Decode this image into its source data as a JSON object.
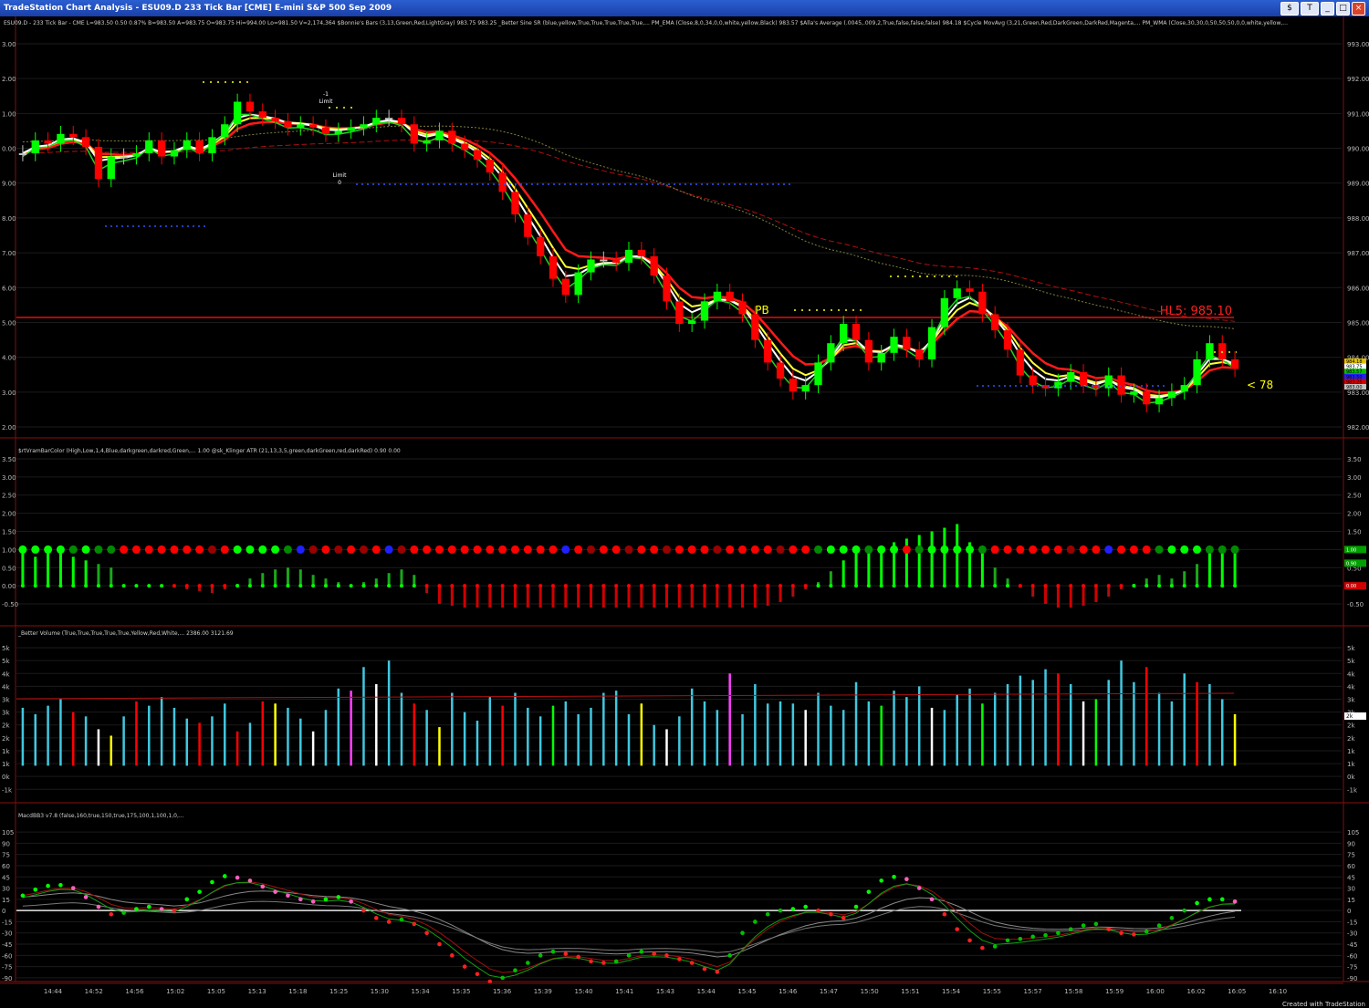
{
  "window": {
    "title": "TradeStation Chart Analysis - ESU09.D 233 Tick Bar [CME] E-mini S&P 500 Sep 2009",
    "btn1": "$",
    "btn2": "T"
  },
  "footer": "Created with TradeStation",
  "colors": {
    "bg": "#000000",
    "grid": "#1b1b1b",
    "bull": "#00ff00",
    "bear": "#ff0000",
    "neutral": "#c0c0c0",
    "white": "#ffffff",
    "yellow": "#ffff00",
    "red_line": "#e01818",
    "green_line": "#00d000",
    "cyan": "#40c8e0",
    "blue": "#2020ff",
    "magenta": "#ff40ff"
  },
  "time_axis": [
    "14:44",
    "14:52",
    "14:56",
    "15:02",
    "15:05",
    "15:13",
    "15:18",
    "15:25",
    "15:30",
    "15:34",
    "15:35",
    "15:36",
    "15:39",
    "15:40",
    "15:41",
    "15:43",
    "15:44",
    "15:45",
    "15:46",
    "15:47",
    "15:50",
    "15:51",
    "15:54",
    "15:55",
    "15:57",
    "15:58",
    "15:59",
    "16:00",
    "16:02",
    "16:05",
    "16:10"
  ],
  "chart_data": [
    {
      "type": "candlestick",
      "status": "ESU09.D - 233 Tick Bar - CME  L=983.50  0.50  0.87%  B=983.50  A=983.75  O=983.75  Hi=994.00  Lo=981.50  V=2,174,364  $Bonnie's Bars (3,13,Green,Red,LightGray)  983.75  983.25  _Better Sine SR (blue,yellow,True,True,True,True,True,...  PM_EMA (Close,8,0,34,0,0,white,yellow,Black)  983.57  $Alla's Average (.0045,.009,2,True,false,false,false)  984.18  $Cycle MovAvg (3,21,Green,Red,DarkGreen,DarkRed,Magenta,...  PM_WMA (Close,30,30,0,50,50,50,0,0,white,yellow,...",
      "y_ticks_left": [
        "3.00",
        "2.00",
        "1.00",
        "0.00",
        "9.00",
        "8.00",
        "7.00",
        "6.00",
        "5.00",
        "4.00",
        "3.00",
        "2.00"
      ],
      "y_ticks_right": [
        "993.00",
        "992.00",
        "991.00",
        "990.00",
        "989.00",
        "988.00",
        "987.00",
        "986.00",
        "985.00",
        "984.00",
        "983.00",
        "982.00"
      ],
      "ylim": [
        981.7,
        993.6
      ],
      "close": [
        990.2,
        990.6,
        990.5,
        990.8,
        990.7,
        990.4,
        989.4,
        990.1,
        990.1,
        990.2,
        990.6,
        990.1,
        990.3,
        990.6,
        990.2,
        990.7,
        991.1,
        991.8,
        991.5,
        991.3,
        991.2,
        991.0,
        991.1,
        991.0,
        990.8,
        990.9,
        991.0,
        991.1,
        991.3,
        991.3,
        991.1,
        990.5,
        990.6,
        990.9,
        990.5,
        990.3,
        990.0,
        989.6,
        989.0,
        988.3,
        987.6,
        987.0,
        986.3,
        985.8,
        986.5,
        986.9,
        986.9,
        986.8,
        987.2,
        987.0,
        986.4,
        985.6,
        984.9,
        985.0,
        985.6,
        985.9,
        985.6,
        985.2,
        984.4,
        983.7,
        983.2,
        982.8,
        983.0,
        983.7,
        984.3,
        984.9,
        984.4,
        983.7,
        984.0,
        984.5,
        984.1,
        983.8,
        984.8,
        985.7,
        986.0,
        985.9,
        985.2,
        984.7,
        984.1,
        983.3,
        983.0,
        982.9,
        983.1,
        983.4,
        983.0,
        982.9,
        983.3,
        982.7,
        982.8,
        982.4,
        982.6,
        982.8,
        983.0,
        983.8,
        984.3,
        983.8,
        983.5
      ],
      "annotations": [
        {
          "text": "PB",
          "color": "#ffff00"
        },
        {
          "text": "HL5: 985.10",
          "color": "#ff2020",
          "value": 985.1
        },
        {
          "text": "< 78",
          "color": "#ffff00"
        },
        {
          "text": "-1",
          "color": "#ffffff"
        },
        {
          "text": "Limit",
          "color": "#ffffff"
        },
        {
          "text": "Limit",
          "color": "#ffffff"
        },
        {
          "text": "0",
          "color": "#ffffff"
        }
      ],
      "price_tags": [
        "984.18",
        "983.75",
        "983.57",
        "983.50",
        "983.25",
        "983.00"
      ]
    },
    {
      "type": "oscillator",
      "status": "$rtVramBarColor (High,Low,1,4,Blue,darkgreen,darkred,Green,...  1.00  @sk_Klinger ATR (21,13,3,5,green,darkGreen,red,darkRed)  0.90  0.00",
      "y_ticks": [
        "3.50",
        "3.00",
        "2.50",
        "2.00",
        "1.50",
        "1.00",
        "0.50",
        "0.00",
        "-0.50"
      ],
      "ylim": [
        -0.6,
        3.55
      ],
      "values": [
        1.0,
        0.8,
        1.0,
        0.9,
        0.8,
        0.7,
        0.6,
        0.5,
        0.0,
        0.02,
        0.02,
        0.0,
        -0.05,
        -0.1,
        -0.15,
        -0.2,
        -0.1,
        0.05,
        0.2,
        0.35,
        0.45,
        0.5,
        0.45,
        0.3,
        0.2,
        0.1,
        0.0,
        0.1,
        0.2,
        0.35,
        0.45,
        0.3,
        -0.2,
        -0.5,
        -0.55,
        -0.6,
        -0.6,
        -0.6,
        -0.6,
        -0.6,
        -0.6,
        -0.6,
        -0.6,
        -0.6,
        -0.6,
        -0.6,
        -0.6,
        -0.6,
        -0.6,
        -0.6,
        -0.6,
        -0.6,
        -0.6,
        -0.6,
        -0.6,
        -0.6,
        -0.6,
        -0.6,
        -0.6,
        -0.55,
        -0.45,
        -0.3,
        -0.1,
        0.1,
        0.4,
        0.7,
        0.9,
        1.0,
        1.1,
        1.2,
        1.3,
        1.4,
        1.5,
        1.6,
        1.7,
        1.2,
        0.9,
        0.5,
        0.2,
        -0.05,
        -0.3,
        -0.5,
        -0.6,
        -0.6,
        -0.55,
        -0.45,
        -0.3,
        -0.1,
        0.05,
        0.2,
        0.3,
        0.2,
        0.4,
        0.6,
        0.9,
        1.0,
        1.0
      ],
      "dot_states": [
        "g",
        "g",
        "g",
        "g",
        "dg",
        "g",
        "dg",
        "dg",
        "r",
        "r",
        "r",
        "r",
        "r",
        "r",
        "r",
        "dr",
        "r",
        "g",
        "g",
        "g",
        "g",
        "dg",
        "b",
        "dr",
        "r",
        "dr",
        "r",
        "dr",
        "r",
        "b",
        "dr",
        "r",
        "r",
        "r",
        "r",
        "r",
        "r",
        "r",
        "r",
        "r",
        "r",
        "r",
        "r",
        "b",
        "r",
        "dr",
        "r",
        "r",
        "dr",
        "r",
        "r",
        "dr",
        "r",
        "r",
        "r",
        "dr",
        "r",
        "r",
        "r",
        "r",
        "dr",
        "r",
        "r",
        "dg",
        "g",
        "g",
        "g",
        "dg",
        "g",
        "g",
        "r",
        "dg",
        "g",
        "g",
        "g",
        "g",
        "dg",
        "r",
        "r",
        "r",
        "r",
        "r",
        "r",
        "dr",
        "r",
        "r",
        "b",
        "r",
        "r",
        "r",
        "dg",
        "g",
        "g",
        "g",
        "dg",
        "dg",
        "dg"
      ],
      "right_tags": [
        "1.00",
        "0.90",
        "0.00"
      ]
    },
    {
      "type": "bar",
      "status": "_Better Volume (True,True,True,True,True,Yellow,Red,White,...  2386.00  3121.69",
      "y_ticks": [
        "5k",
        "5k",
        "4k",
        "4k",
        "3k",
        "3k",
        "2k",
        "2k",
        "1k",
        "1k",
        "0k",
        "-1k"
      ],
      "ylim": [
        -1300,
        5800
      ],
      "values": [
        2700,
        2400,
        2800,
        3100,
        2500,
        2300,
        1700,
        1400,
        2300,
        3000,
        2800,
        3200,
        2700,
        2200,
        2000,
        2300,
        2900,
        1600,
        2000,
        3000,
        2900,
        2700,
        2200,
        1600,
        2600,
        3600,
        3500,
        4600,
        3800,
        4900,
        3400,
        2900,
        2600,
        1800,
        3400,
        2500,
        2100,
        3200,
        2800,
        3400,
        2700,
        2300,
        2800,
        3000,
        2400,
        2700,
        3400,
        3500,
        2400,
        2900,
        1900,
        1700,
        2300,
        3600,
        3000,
        2600,
        4300,
        2400,
        3800,
        2900,
        3000,
        2900,
        2600,
        3400,
        2800,
        2600,
        3900,
        3000,
        2800,
        3500,
        3200,
        3700,
        2700,
        2600,
        3300,
        3600,
        2900,
        3400,
        3800,
        4200,
        4000,
        4500,
        4300,
        3800,
        3000,
        3100,
        4000,
        4900,
        3900,
        4600,
        3400,
        3000,
        4300,
        3900,
        3800,
        3100,
        2400
      ],
      "colors": [
        "c",
        "c",
        "c",
        "c",
        "r",
        "c",
        "w",
        "y",
        "c",
        "r",
        "c",
        "c",
        "c",
        "c",
        "r",
        "c",
        "c",
        "r",
        "c",
        "r",
        "y",
        "c",
        "c",
        "w",
        "c",
        "c",
        "m",
        "c",
        "w",
        "c",
        "c",
        "r",
        "c",
        "y",
        "c",
        "c",
        "c",
        "c",
        "r",
        "c",
        "c",
        "c",
        "g",
        "c",
        "c",
        "c",
        "c",
        "c",
        "c",
        "y",
        "c",
        "w",
        "c",
        "c",
        "c",
        "c",
        "m",
        "c",
        "c",
        "c",
        "c",
        "c",
        "w",
        "c",
        "c",
        "c",
        "c",
        "c",
        "g",
        "c",
        "c",
        "c",
        "w",
        "c",
        "c",
        "c",
        "g",
        "c",
        "c",
        "c",
        "c",
        "c",
        "r",
        "c",
        "w",
        "g",
        "c",
        "c",
        "c",
        "r",
        "c",
        "c",
        "c",
        "r",
        "c",
        "c",
        "y"
      ],
      "ma_value": 3121.69,
      "right_tag": "2k"
    },
    {
      "type": "line",
      "status": "MacdBB3 v7.8 (false,160,true,150,true,175,100,1,100,1,0,...",
      "y_ticks": [
        "105",
        "90",
        "75",
        "60",
        "45",
        "30",
        "15",
        "0",
        "-15",
        "-30",
        "-45",
        "-60",
        "-75",
        "-90"
      ],
      "ylim": [
        -95,
        110
      ],
      "values": [
        20,
        28,
        33,
        34,
        30,
        18,
        5,
        -5,
        -3,
        2,
        5,
        2,
        0,
        15,
        25,
        38,
        46,
        44,
        40,
        32,
        25,
        20,
        15,
        12,
        15,
        18,
        12,
        0,
        -10,
        -15,
        -12,
        -18,
        -30,
        -45,
        -60,
        -75,
        -85,
        -95,
        -90,
        -80,
        -70,
        -60,
        -55,
        -58,
        -62,
        -68,
        -70,
        -68,
        -60,
        -55,
        -58,
        -60,
        -65,
        -70,
        -78,
        -82,
        -60,
        -30,
        -15,
        -5,
        0,
        2,
        5,
        0,
        -5,
        -10,
        5,
        25,
        40,
        45,
        42,
        30,
        15,
        -5,
        -25,
        -40,
        -50,
        -48,
        -40,
        -38,
        -35,
        -33,
        -30,
        -25,
        -20,
        -18,
        -25,
        -30,
        -32,
        -28,
        -20,
        -10,
        0,
        10,
        15,
        15,
        12
      ]
    }
  ]
}
